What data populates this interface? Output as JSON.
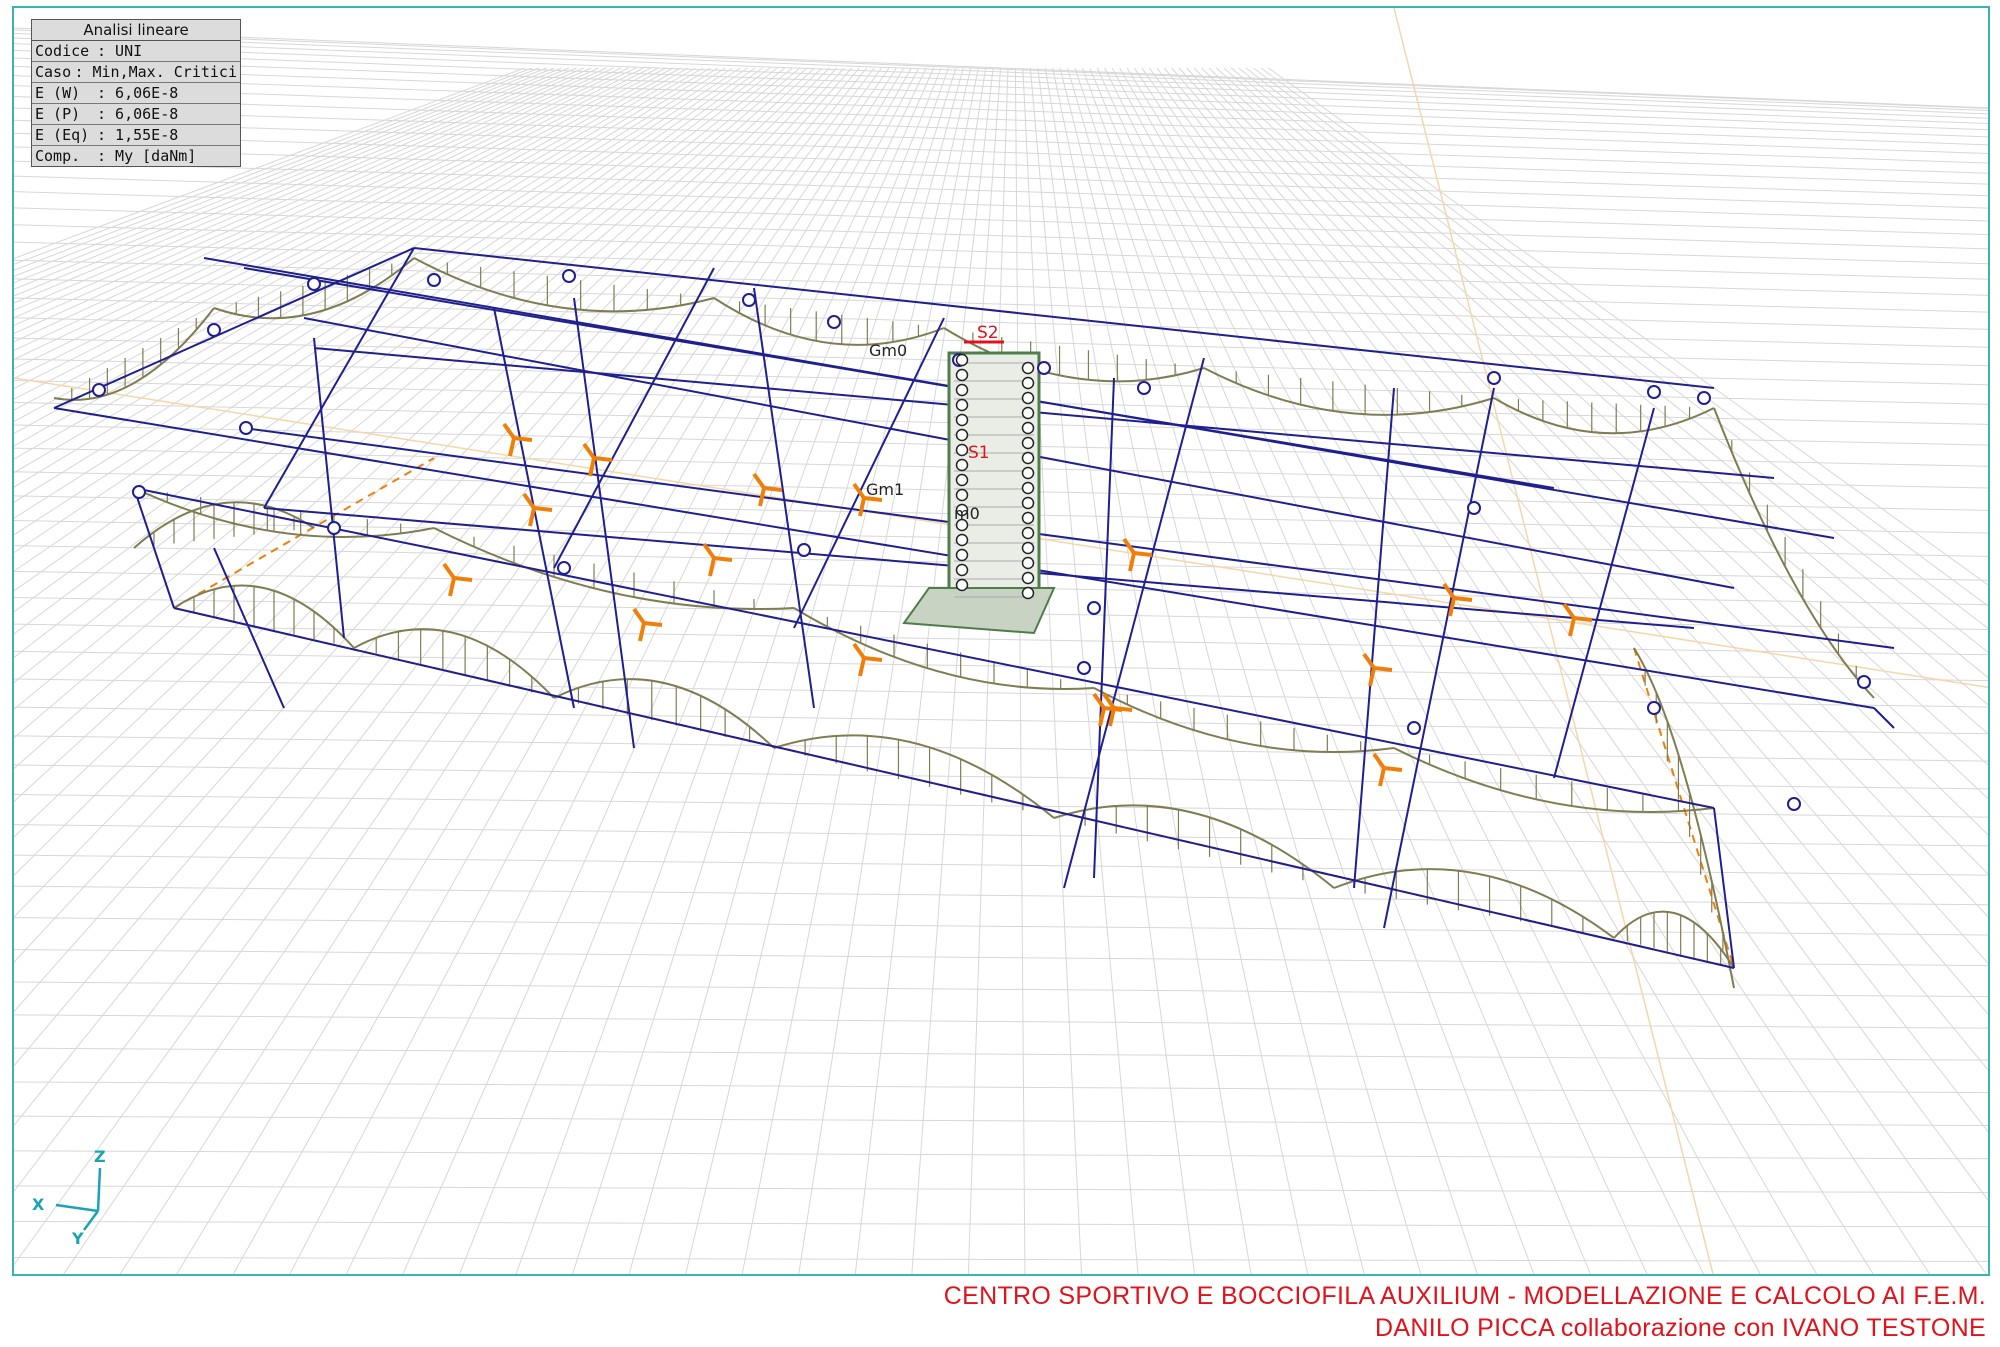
{
  "info_panel": {
    "title": "Analisi lineare",
    "rows": [
      {
        "key": "Codice",
        "value": ": UNI"
      },
      {
        "key": "Caso",
        "value": ": Min,Max. Critici"
      },
      {
        "key": "E (W)",
        "value": ": 6,06E-8"
      },
      {
        "key": "E (P)",
        "value": ": 6,06E-8"
      },
      {
        "key": "E (Eq)",
        "value": ": 1,55E-8"
      },
      {
        "key": "Comp.",
        "value": ": My [daNm]"
      }
    ]
  },
  "labels": {
    "s2": "S2",
    "s1": "S1",
    "gm0": "Gm0",
    "gm1": "Gm1",
    "m0": "m0"
  },
  "axes": {
    "x": "X",
    "y": "Y",
    "z": "Z"
  },
  "footer": {
    "line1": "CENTRO SPORTIVO E BOCCIOFILA AUXILIUM - MODELLAZIONE E CALCOLO AI F.E.M.",
    "line2": "DANILO PICCA collaborazione con IVANO TESTONE"
  },
  "colors": {
    "frame": "#1f1f8f",
    "diagram": "#7f7d52",
    "support": "#f07f0a",
    "label_red": "#e0121b",
    "grid": "#d7d7d7",
    "border": "#3bb3b3"
  }
}
